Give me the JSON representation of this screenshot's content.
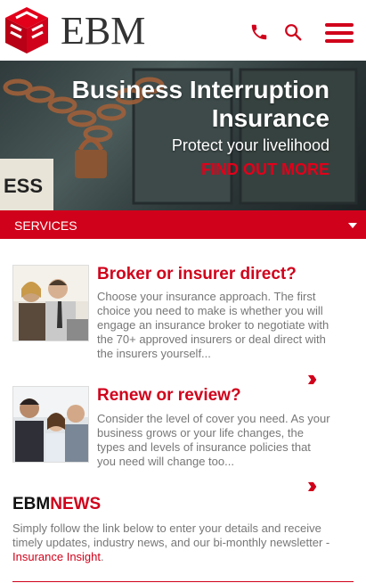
{
  "header": {
    "logo_text": "EBM",
    "phone_icon": "phone-icon",
    "search_icon": "search-icon",
    "menu_icon": "hamburger-menu-icon",
    "brand_color": "#d0021b"
  },
  "hero": {
    "title_line1": "Business Interruption",
    "title_line2": "Insurance",
    "subtitle": "Protect your livelihood",
    "cta": "FIND OUT MORE"
  },
  "services": {
    "label": "SERVICES",
    "toggle_icon": "caret-down-icon"
  },
  "cards": [
    {
      "title": "Broker or insurer direct?",
      "text": "Choose your insurance approach. The first choice you need to make is whether you will engage an insurance broker to negotiate with the 70+ approved insurers or deal direct with the insurers yourself...",
      "more_icon": "double-chevron-right-icon"
    },
    {
      "title": "Renew or review?",
      "text": "Consider the level of cover you need. As your business grows or your life changes, the types and levels of insurance policies that you need will change too...",
      "more_icon": "double-chevron-right-icon"
    }
  ],
  "news": {
    "title_part1": "EBM",
    "title_part2": "NEWS",
    "text": "Simply follow the link below to enter your details and receive timely updates, industry news, and our bi-monthly newsletter - ",
    "link": "Insurance Insight",
    "trailing": "."
  }
}
